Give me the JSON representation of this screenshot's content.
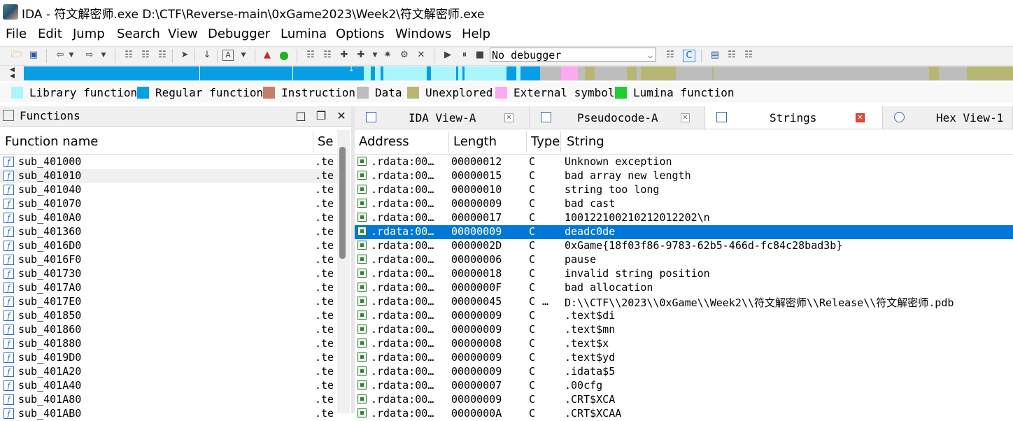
{
  "window": {
    "title": "IDA - 符文解密师.exe D:\\CTF\\Reverse-main\\0xGame2023\\Week2\\符文解密师.exe"
  },
  "menu": [
    "File",
    "Edit",
    "Jump",
    "Search",
    "View",
    "Debugger",
    "Lumina",
    "Options",
    "Windows",
    "Help"
  ],
  "toolbar": {
    "debugger_select": "No debugger"
  },
  "legend": [
    {
      "label": "Library function",
      "color": "#aaf6fb"
    },
    {
      "label": "Regular function",
      "color": "#079fe4"
    },
    {
      "label": "Instruction",
      "color": "#c0806c"
    },
    {
      "label": "Data",
      "color": "#bdbdbd"
    },
    {
      "label": "Unexplored",
      "color": "#b6b675"
    },
    {
      "label": "External symbol",
      "color": "#fcaaf0"
    },
    {
      "label": "Lumina function",
      "color": "#22cc33"
    }
  ],
  "functions_pane": {
    "title": "Functions",
    "col_name": "Function name",
    "col_segment": "Se",
    "rows": [
      {
        "name": "sub_401000",
        "seg": ".te"
      },
      {
        "name": "sub_401010",
        "seg": ".te"
      },
      {
        "name": "sub_401040",
        "seg": ".te"
      },
      {
        "name": "sub_401070",
        "seg": ".te"
      },
      {
        "name": "sub_4010A0",
        "seg": ".te"
      },
      {
        "name": "sub_401360",
        "seg": ".te"
      },
      {
        "name": "sub_4016D0",
        "seg": ".te"
      },
      {
        "name": "sub_4016F0",
        "seg": ".te"
      },
      {
        "name": "sub_401730",
        "seg": ".te"
      },
      {
        "name": "sub_4017A0",
        "seg": ".te"
      },
      {
        "name": "sub_4017E0",
        "seg": ".te"
      },
      {
        "name": "sub_401850",
        "seg": ".te"
      },
      {
        "name": "sub_401860",
        "seg": ".te"
      },
      {
        "name": "sub_401880",
        "seg": ".te"
      },
      {
        "name": "sub_4019D0",
        "seg": ".te"
      },
      {
        "name": "sub_401A20",
        "seg": ".te"
      },
      {
        "name": "sub_401A40",
        "seg": ".te"
      },
      {
        "name": "sub_401A80",
        "seg": ".te"
      },
      {
        "name": "sub_401AB0",
        "seg": ".te"
      }
    ]
  },
  "tabs": [
    {
      "label": "IDA View-A"
    },
    {
      "label": "Pseudocode-A"
    },
    {
      "label": "Strings"
    },
    {
      "label": "Hex View-1"
    }
  ],
  "strings": {
    "col_address": "Address",
    "col_length": "Length",
    "col_type": "Type",
    "col_string": "String",
    "rows": [
      {
        "addr": ".rdata:00…",
        "len": "00000012",
        "type": "C",
        "ext": "",
        "str": "Unknown exception"
      },
      {
        "addr": ".rdata:00…",
        "len": "00000015",
        "type": "C",
        "ext": "",
        "str": "bad array new length"
      },
      {
        "addr": ".rdata:00…",
        "len": "00000010",
        "type": "C",
        "ext": "",
        "str": "string too long"
      },
      {
        "addr": ".rdata:00…",
        "len": "00000009",
        "type": "C",
        "ext": "",
        "str": "bad cast"
      },
      {
        "addr": ".rdata:00…",
        "len": "00000017",
        "type": "C",
        "ext": "",
        "str": "10012210021021201220​2\\n"
      },
      {
        "addr": ".rdata:00…",
        "len": "00000009",
        "type": "C",
        "ext": "",
        "str": "deadc0de"
      },
      {
        "addr": ".rdata:00…",
        "len": "0000002D",
        "type": "C",
        "ext": "",
        "str": "0xGame{18f03f86-9783-62b5-466d-fc84c28bad3b}"
      },
      {
        "addr": ".rdata:00…",
        "len": "00000006",
        "type": "C",
        "ext": "",
        "str": "pause"
      },
      {
        "addr": ".rdata:00…",
        "len": "00000018",
        "type": "C",
        "ext": "",
        "str": "invalid string position"
      },
      {
        "addr": ".rdata:00…",
        "len": "0000000F",
        "type": "C",
        "ext": "",
        "str": "bad allocation"
      },
      {
        "addr": ".rdata:00…",
        "len": "00000045",
        "type": "C",
        "ext": "…",
        "str": "D:\\\\CTF\\\\2023\\\\0xGame\\\\Week2\\\\符文解密师\\\\Release\\\\符文解密师.pdb"
      },
      {
        "addr": ".rdata:00…",
        "len": "00000009",
        "type": "C",
        "ext": "",
        "str": ".text$di"
      },
      {
        "addr": ".rdata:00…",
        "len": "00000009",
        "type": "C",
        "ext": "",
        "str": ".text$mn"
      },
      {
        "addr": ".rdata:00…",
        "len": "00000008",
        "type": "C",
        "ext": "",
        "str": ".text$x"
      },
      {
        "addr": ".rdata:00…",
        "len": "00000009",
        "type": "C",
        "ext": "",
        "str": ".text$yd"
      },
      {
        "addr": ".rdata:00…",
        "len": "00000009",
        "type": "C",
        "ext": "",
        "str": ".idata$5"
      },
      {
        "addr": ".rdata:00…",
        "len": "00000007",
        "type": "C",
        "ext": "",
        "str": ".00cfg"
      },
      {
        "addr": ".rdata:00…",
        "len": "00000009",
        "type": "C",
        "ext": "",
        "str": ".CRT$XCA"
      },
      {
        "addr": ".rdata:00…",
        "len": "0000000A",
        "type": "C",
        "ext": "",
        "str": ".CRT$XCAA"
      }
    ]
  },
  "colors": {
    "selection": "#0078d7",
    "regular_function": "#079fe4",
    "library_function": "#aaf6fb"
  }
}
